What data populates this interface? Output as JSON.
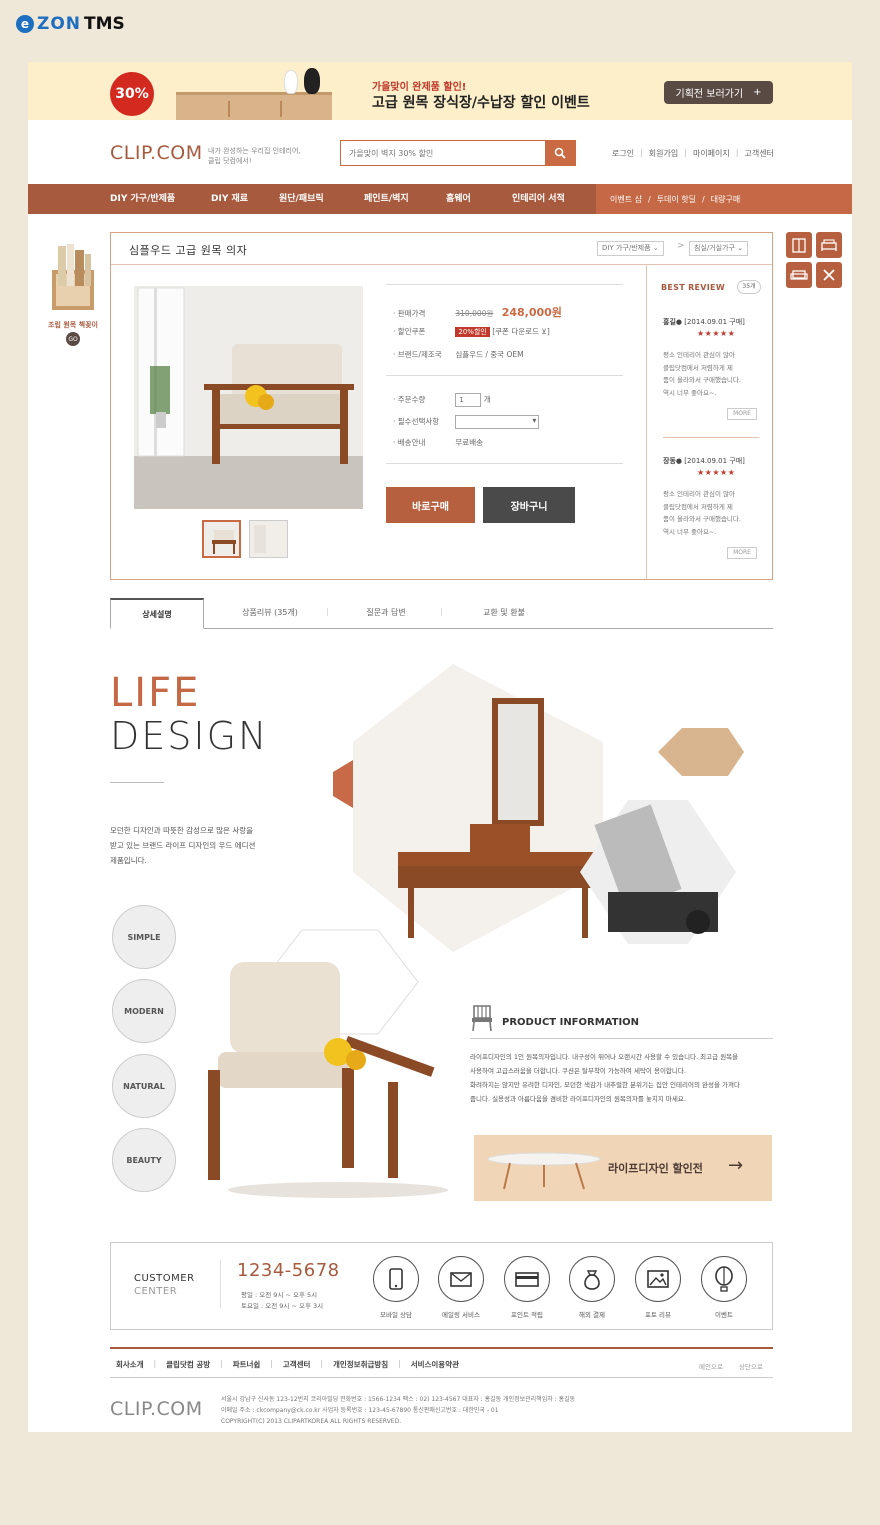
{
  "brand": {
    "e": "e",
    "zon": "ZON",
    "tms": "TMS"
  },
  "banner": {
    "badge": "30%",
    "subtitle": "가을맞이 완제품 할인!",
    "title": "고급 원목 장식장/수납장 할인 이벤트",
    "button": "기획전 보러가기",
    "button_icon": "+"
  },
  "header": {
    "logo_main": "CLIP",
    "logo_dot": ".",
    "logo_com": "COM",
    "logo_desc_1": "내가 완성하는 우리집 인테리어,",
    "logo_desc_2": "클립 닷컴에서!",
    "search_placeholder": "가을맞이 벽지 30% 할인",
    "util": [
      "로그인",
      "회원가입",
      "마이페이지",
      "고객센터"
    ]
  },
  "nav": {
    "items": [
      "DIY 가구/반제품",
      "DIY 재료",
      "원단/패브릭",
      "페인트/벽지",
      "홈웨어",
      "인테리어 서적"
    ],
    "right": [
      "이벤트 샵",
      "투데이 핫딜",
      "대량구매"
    ]
  },
  "side": {
    "label": "조립 원목 책꽂이",
    "go": "GO"
  },
  "product": {
    "title": "심플우드 고급 원목 의자",
    "crumb1": "DIY 가구/반제품",
    "crumb2": "침실/거실가구",
    "price_label": "판매가격",
    "price_old": "310,000원",
    "price_new": "248,000원",
    "coupon_label": "할인쿠폰",
    "coupon_badge": "20%할인",
    "coupon_download": "[쿠폰 다운로드 ⊻]",
    "brand_label": "브랜드/제조국",
    "brand_value": "심플우드 / 중국 OEM",
    "qty_label": "주문수량",
    "qty_value": "1",
    "qty_unit": "개",
    "option_label": "필수선택사항",
    "ship_label": "배송안내",
    "ship_value": "무료배송",
    "buy": "바로구매",
    "cart": "장바구니"
  },
  "reviews": {
    "title": "BEST REVIEW",
    "count": "35개",
    "items": [
      {
        "author": "홍길●",
        "date": "[2014.09.01 구매]",
        "stars": "★★★★★",
        "text": [
          "평소 인테리어 관심이 많아",
          "클립닷컴에서 저렴하게 제",
          "품이 올라와서 구매했습니다.",
          "역시 너무 좋아요~."
        ],
        "more": "MORE"
      },
      {
        "author": "장동●",
        "date": "[2014.09.01 구매]",
        "stars": "★★★★★",
        "text": [
          "평소 인테리어 관심이 많아",
          "클립닷컴에서 저렴하게 제",
          "품이 올라와서 구매했습니다.",
          "역시 너무 좋아요~."
        ],
        "more": "MORE"
      }
    ]
  },
  "tabs": [
    "상세설명",
    "상품리뷰 (35개)",
    "질문과 답변",
    "교환 및 환불"
  ],
  "life": {
    "word1": "LIFE",
    "word2": "DESIGN",
    "desc": [
      "모던한 디자인과 따뜻한 감성으로 많은 사랑을",
      "받고 있는 브랜드 라이프 디자인의 우드 에디션",
      "제품입니다."
    ],
    "circles": [
      "SIMPLE",
      "MODERN",
      "NATURAL",
      "BEAUTY"
    ],
    "pi_title": "PRODUCT INFORMATION",
    "pi_text": [
      "라이프디자인의 1인 원목의자입니다. 내구성이 뛰어나 오랜시간 사용할 수 있습니다. 최고급 원목을",
      "사용하여 고급스러움을 더합니다. 쿠션은 탈부착이 가능하여 세탁이 용이합니다.",
      "화려하지는 않지만 유려한 디자인, 모던한 색감가 내추럴한 분위기는 집안 인테리어의 완성을 가져다",
      "줍니다. 실용성과 아름다움을 겸비한 라이프디자인의 원목의자를 놓치지 마세요."
    ],
    "promo": "라이프디자인 할인전",
    "promo_arrow": "→"
  },
  "customer": {
    "title1": "CUSTOMER",
    "title2": "CENTER",
    "phone": "1234-5678",
    "hours1": "평일 : 오전 9시 ~ 오후 5시",
    "hours2": "토요일 : 오전 9시 ~ 오후 3시",
    "services": [
      "모바일 상담",
      "메일링 서비스",
      "포인트 적립",
      "해외 결제",
      "포토 리뷰",
      "이벤트"
    ]
  },
  "footer": {
    "links": [
      "회사소개",
      "클립닷컴 공방",
      "파트너쉽",
      "고객센터",
      "개인정보취급방침",
      "서비스이용약관"
    ],
    "right": [
      "메인으로",
      "상단으로"
    ],
    "logo_main": "CLIP",
    "logo_dot": ".",
    "logo_com": "COM",
    "addr1": "서울시 강남구 신사동 123-12번지 코리아빌딩     전화번호 : 1566-1234    팩스 : 02) 123-4567    대표자 : 홍길동    개인정보관리책임자 : 홍길동",
    "addr2": "이메일 주소 : ckcompany@ck.co.kr    사업자 등록번호 : 123-45-67890    통신판매신고번호 : 대한민국 - 01",
    "addr3": "COPYRIGHT(C) 2013 CLIPARTKOREA ALL RIGHTS RESERVED."
  }
}
